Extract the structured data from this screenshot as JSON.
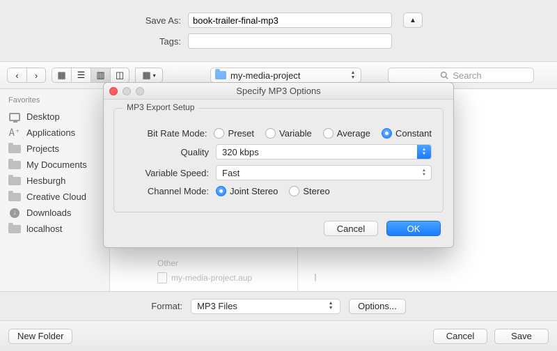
{
  "top": {
    "save_as_label": "Save As:",
    "save_as_value": "book-trailer-final-mp3",
    "tags_label": "Tags:",
    "tags_value": ""
  },
  "toolbar": {
    "path_folder": "my-media-project",
    "search_placeholder": "Search"
  },
  "sidebar": {
    "header": "Favorites",
    "items": [
      {
        "label": "Desktop"
      },
      {
        "label": "Applications"
      },
      {
        "label": "Projects"
      },
      {
        "label": "My Documents"
      },
      {
        "label": "Hesburgh"
      },
      {
        "label": "Creative Cloud"
      },
      {
        "label": "Downloads"
      },
      {
        "label": "localhost"
      }
    ]
  },
  "file_list": {
    "group_header": "Other",
    "file_name": "my-media-project.aup"
  },
  "format_bar": {
    "label": "Format:",
    "value": "MP3 Files",
    "options_label": "Options..."
  },
  "actions": {
    "new_folder": "New Folder",
    "cancel": "Cancel",
    "save": "Save"
  },
  "sheet": {
    "title": "Specify MP3 Options",
    "group_title": "MP3 Export Setup",
    "bit_rate_label": "Bit Rate Mode:",
    "bit_rate_options": [
      "Preset",
      "Variable",
      "Average",
      "Constant"
    ],
    "bit_rate_selected": "Constant",
    "quality_label": "Quality",
    "quality_value": "320 kbps",
    "var_speed_label": "Variable Speed:",
    "var_speed_value": "Fast",
    "channel_label": "Channel Mode:",
    "channel_options": [
      "Joint Stereo",
      "Stereo"
    ],
    "channel_selected": "Joint Stereo",
    "cancel": "Cancel",
    "ok": "OK"
  }
}
